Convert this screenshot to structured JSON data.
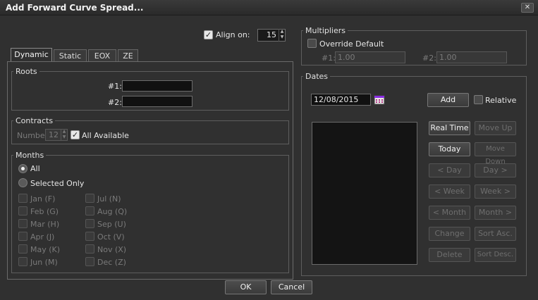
{
  "window": {
    "title": "Add Forward Curve Spread...",
    "close": "✕"
  },
  "align": {
    "label": "Align on:",
    "value": "15",
    "checked": true
  },
  "tabs": [
    "Dynamic",
    "Static",
    "EOX",
    "ZE"
  ],
  "roots": {
    "title": "Roots",
    "r1_label": "#1:",
    "r2_label": "#2:",
    "r1_value": "",
    "r2_value": ""
  },
  "contracts": {
    "title": "Contracts",
    "number_label": "Number",
    "number_value": "12",
    "all_available": "All Available"
  },
  "months": {
    "title": "Months",
    "all": "All",
    "selected_only": "Selected Only",
    "left": [
      "Jan (F)",
      "Feb (G)",
      "Mar (H)",
      "Apr (J)",
      "May (K)",
      "Jun (M)"
    ],
    "right": [
      "Jul (N)",
      "Aug (Q)",
      "Sep (U)",
      "Oct (V)",
      "Nov (X)",
      "Dec (Z)"
    ]
  },
  "multipliers": {
    "title": "Multipliers",
    "override": "Override Default",
    "m1_label": "#1:",
    "m1_value": "1.00",
    "m2_label": "#2:",
    "m2_value": "1.00"
  },
  "dates": {
    "title": "Dates",
    "date_value": "12/08/2015",
    "add": "Add",
    "relative": "Relative",
    "buttons_left": [
      "Real Time",
      "Today",
      "< Day",
      "< Week",
      "< Month",
      "Change",
      "Delete"
    ],
    "buttons_right": [
      "Move Up",
      "Move Down",
      "Day >",
      "Week >",
      "Month >",
      "Sort Asc.",
      "Sort Desc."
    ]
  },
  "footer": {
    "ok": "OK",
    "cancel": "Cancel"
  }
}
